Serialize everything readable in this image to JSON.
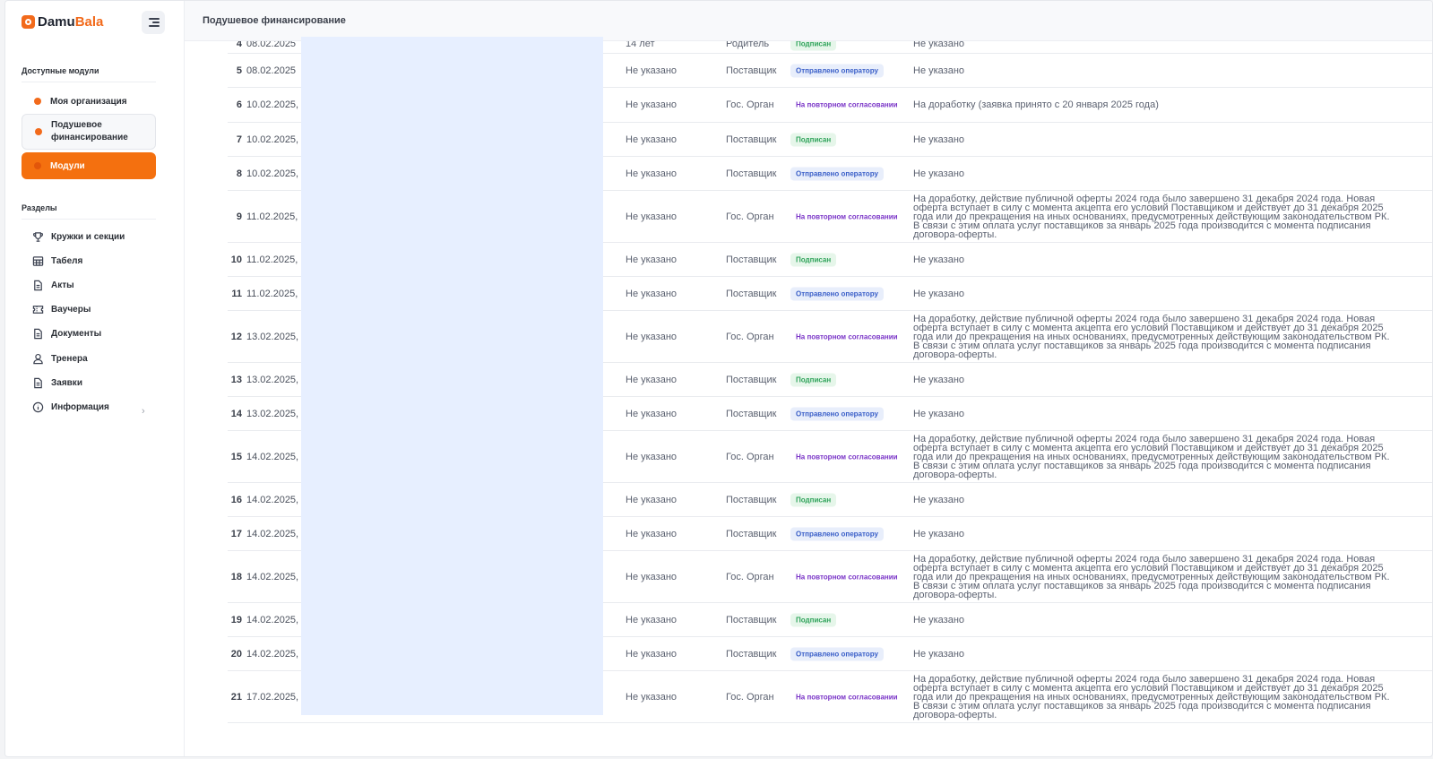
{
  "sidebar": {
    "logo_part1": "Damu",
    "logo_part2": "Bala",
    "modules_title": "Доступные модули",
    "modules": [
      {
        "label": "Моя организация"
      },
      {
        "label": "Подушевое финансирование"
      },
      {
        "label": "Модули"
      }
    ],
    "sections_title": "Разделы",
    "sections": [
      {
        "label": "Кружки и секции"
      },
      {
        "label": "Табеля"
      },
      {
        "label": "Акты"
      },
      {
        "label": "Ваучеры"
      },
      {
        "label": "Документы"
      },
      {
        "label": "Тренера"
      },
      {
        "label": "Заявки"
      },
      {
        "label": "Информация"
      }
    ]
  },
  "header": {
    "title": "Подушевое финансирование"
  },
  "statuses": {
    "sent": "Отправлено оператору",
    "signed": "Подписан",
    "repeat": "На повторном согласовании"
  },
  "long_comment": "На доработку, действие публичной оферты 2024 года было завершено 31 декабря 2024 года. Новая оферта вступает в силу с момента акцепта его условий Поставщиком и действует до 31 декабря 2025 года или до прекращения на иных основаниях, предусмотренных действующим законодательством РК. В связи с этим оплата услуг поставщиков за январь 2025 года производится с момента подписания договора-оферты.",
  "rows": [
    {
      "num": "4",
      "date": "08.02.2025",
      "who": "14 лет",
      "role": "Родитель",
      "status": "Подписан",
      "status_type": "signed",
      "comment": "Не указано"
    },
    {
      "num": "5",
      "date": "08.02.2025",
      "who": "Не указано",
      "role": "Поставщик",
      "status": "Отправлено оператору",
      "status_type": "sent",
      "comment": "Не указано"
    },
    {
      "num": "6",
      "date": "10.02.2025,",
      "who": "Не указано",
      "role": "Гос. Орган",
      "status": "На повторном согласовании",
      "status_type": "repeat",
      "comment": "На доработку (заявка принято с 20 января 2025 года)"
    },
    {
      "num": "7",
      "date": "10.02.2025,",
      "who": "Не указано",
      "role": "Поставщик",
      "status": "Подписан",
      "status_type": "signed",
      "comment": "Не указано"
    },
    {
      "num": "8",
      "date": "10.02.2025,",
      "who": "Не указано",
      "role": "Поставщик",
      "status": "Отправлено оператору",
      "status_type": "sent",
      "comment": "Не указано"
    },
    {
      "num": "9",
      "date": "11.02.2025,",
      "who": "Не указано",
      "role": "Гос. Орган",
      "status": "На повторном согласовании",
      "status_type": "repeat",
      "comment": "long"
    },
    {
      "num": "10",
      "date": "11.02.2025,",
      "who": "Не указано",
      "role": "Поставщик",
      "status": "Подписан",
      "status_type": "signed",
      "comment": "Не указано"
    },
    {
      "num": "11",
      "date": "11.02.2025,",
      "who": "Не указано",
      "role": "Поставщик",
      "status": "Отправлено оператору",
      "status_type": "sent",
      "comment": "Не указано"
    },
    {
      "num": "12",
      "date": "13.02.2025,",
      "who": "Не указано",
      "role": "Гос. Орган",
      "status": "На повторном согласовании",
      "status_type": "repeat",
      "comment": "long"
    },
    {
      "num": "13",
      "date": "13.02.2025,",
      "who": "Не указано",
      "role": "Поставщик",
      "status": "Подписан",
      "status_type": "signed",
      "comment": "Не указано"
    },
    {
      "num": "14",
      "date": "13.02.2025,",
      "who": "Не указано",
      "role": "Поставщик",
      "status": "Отправлено оператору",
      "status_type": "sent",
      "comment": "Не указано"
    },
    {
      "num": "15",
      "date": "14.02.2025,",
      "who": "Не указано",
      "role": "Гос. Орган",
      "status": "На повторном согласовании",
      "status_type": "repeat",
      "comment": "long"
    },
    {
      "num": "16",
      "date": "14.02.2025,",
      "who": "Не указано",
      "role": "Поставщик",
      "status": "Подписан",
      "status_type": "signed",
      "comment": "Не указано"
    },
    {
      "num": "17",
      "date": "14.02.2025,",
      "who": "Не указано",
      "role": "Поставщик",
      "status": "Отправлено оператору",
      "status_type": "sent",
      "comment": "Не указано"
    },
    {
      "num": "18",
      "date": "14.02.2025,",
      "who": "Не указано",
      "role": "Гос. Орган",
      "status": "На повторном согласовании",
      "status_type": "repeat",
      "comment": "long"
    },
    {
      "num": "19",
      "date": "14.02.2025,",
      "who": "Не указано",
      "role": "Поставщик",
      "status": "Подписан",
      "status_type": "signed",
      "comment": "Не указано"
    },
    {
      "num": "20",
      "date": "14.02.2025,",
      "who": "Не указано",
      "role": "Поставщик",
      "status": "Отправлено оператору",
      "status_type": "sent",
      "comment": "Не указано"
    },
    {
      "num": "21",
      "date": "17.02.2025,",
      "who": "Не указано",
      "role": "Гос. Орган",
      "status": "На повторном согласовании",
      "status_type": "repeat",
      "comment": "long"
    }
  ]
}
